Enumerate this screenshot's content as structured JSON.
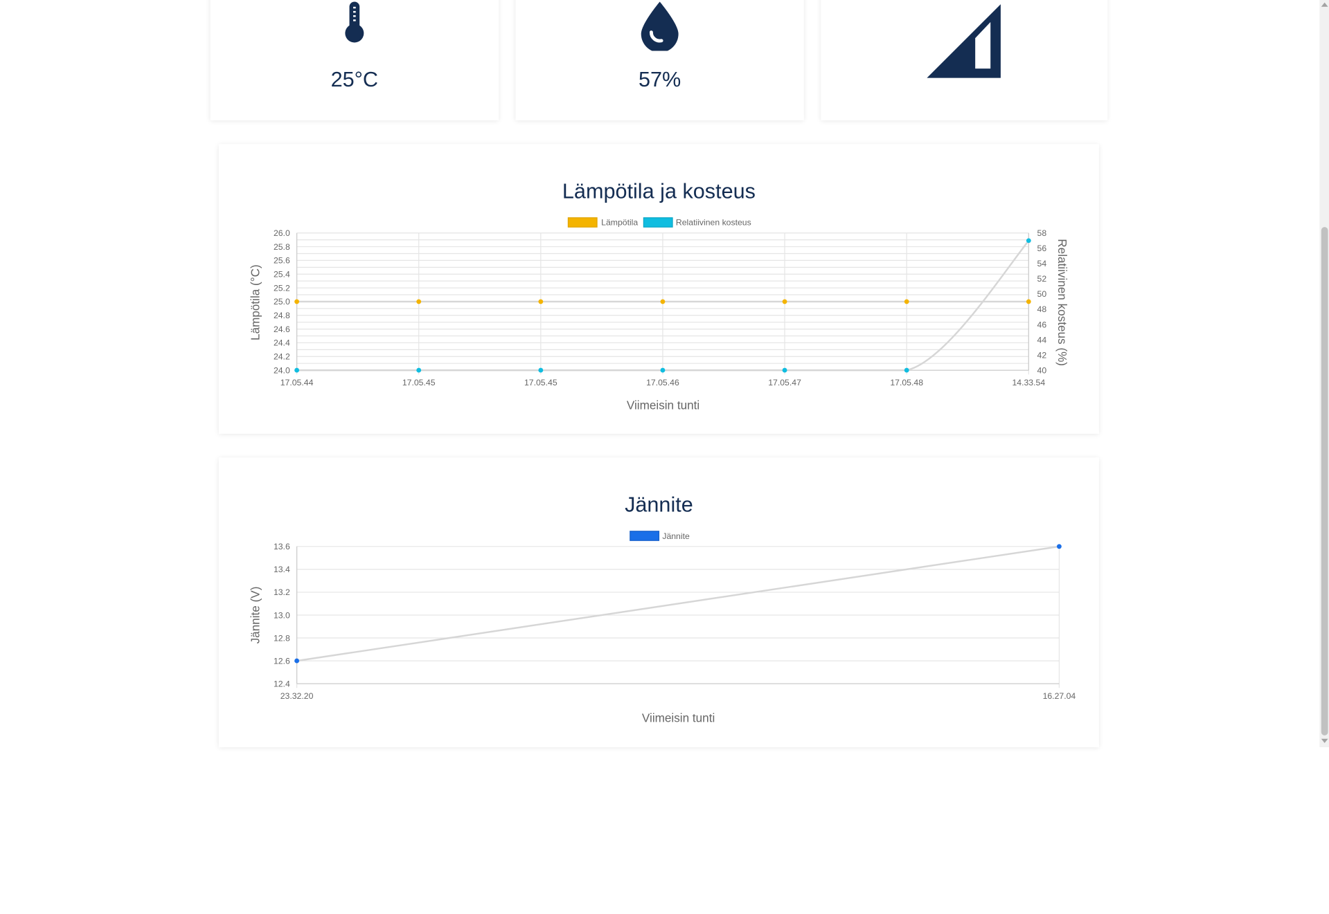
{
  "colors": {
    "navy": "#142d52",
    "temp": "#f4b400",
    "humidity": "#10bde0",
    "voltage": "#1a6fe8",
    "grid": "#e5e5e5",
    "line": "#d6d6d6"
  },
  "stats": [
    {
      "icon": "thermometer-icon",
      "value": "25°C"
    },
    {
      "icon": "water-drop-icon",
      "value": "57%"
    },
    {
      "icon": "signal-strength-icon",
      "value": ""
    }
  ],
  "chart1": {
    "title": "Lämpötila ja kosteus",
    "legend": [
      "Lämpötila",
      "Relatiivinen kosteus"
    ],
    "y_left_label": "Lämpötila (°C)",
    "y_right_label": "Relatiivinen kosteus (%)",
    "x_label": "Viimeisin tunti",
    "y_left_ticks": [
      "26.0",
      "25.8",
      "25.6",
      "25.4",
      "25.2",
      "25.0",
      "24.8",
      "24.6",
      "24.4",
      "24.2",
      "24.0"
    ],
    "y_right_ticks": [
      "58",
      "56",
      "54",
      "52",
      "50",
      "48",
      "46",
      "44",
      "42",
      "40"
    ],
    "x_ticks": [
      "17.05.44",
      "17.05.45",
      "17.05.45",
      "17.05.46",
      "17.05.47",
      "17.05.48",
      "14.33.54"
    ]
  },
  "chart2": {
    "title": "Jännite",
    "legend": [
      "Jännite"
    ],
    "y_label": "Jännite (V)",
    "x_label": "Viimeisin tunti",
    "y_ticks": [
      "13.6",
      "13.4",
      "13.2",
      "13.0",
      "12.8",
      "12.6",
      "12.4"
    ],
    "x_ticks": [
      "23.32.20",
      "16.27.04"
    ]
  },
  "chart_data": [
    {
      "type": "line",
      "title": "Lämpötila ja kosteus",
      "xlabel": "Viimeisin tunti",
      "ylabel": "Lämpötila (°C)",
      "y2label": "Relatiivinen kosteus (%)",
      "x": [
        "17.05.44",
        "17.05.45",
        "17.05.45",
        "17.05.46",
        "17.05.47",
        "17.05.48",
        "14.33.54"
      ],
      "ylim": [
        24.0,
        26.0
      ],
      "y2lim": [
        40,
        58
      ],
      "legend": "top",
      "grid": true,
      "series": [
        {
          "name": "Lämpötila",
          "axis": "left",
          "values": [
            25,
            25,
            25,
            25,
            25,
            25,
            25
          ]
        },
        {
          "name": "Relatiivinen kosteus",
          "axis": "right",
          "values": [
            40,
            40,
            40,
            40,
            40,
            40,
            57
          ]
        }
      ]
    },
    {
      "type": "line",
      "title": "Jännite",
      "xlabel": "Viimeisin tunti",
      "ylabel": "Jännite (V)",
      "x": [
        "23.32.20",
        "16.27.04"
      ],
      "ylim": [
        12.4,
        13.6
      ],
      "legend": "top",
      "grid": true,
      "series": [
        {
          "name": "Jännite",
          "values": [
            12.6,
            13.6
          ]
        }
      ]
    }
  ]
}
